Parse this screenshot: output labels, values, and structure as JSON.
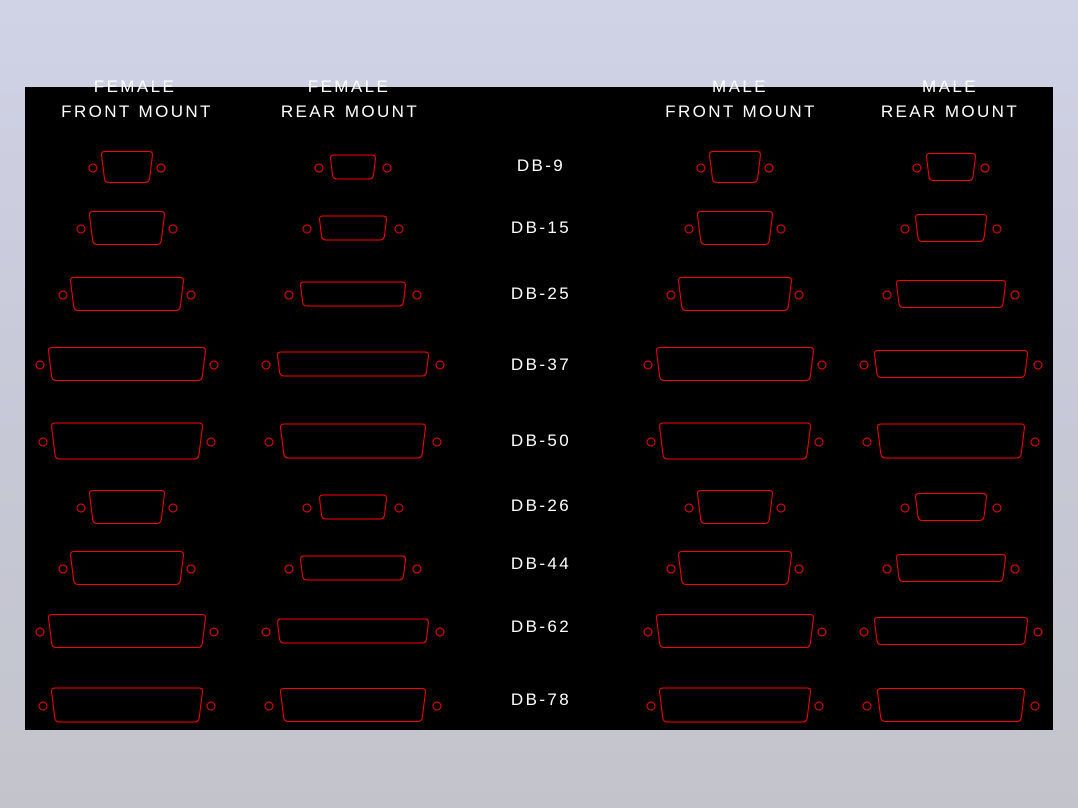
{
  "colors": {
    "canvas": "#000000",
    "outline": "#ff0000",
    "text": "#ffffff"
  },
  "headers": [
    {
      "line1": "FEMALE",
      "line2": "FRONT MOUNT"
    },
    {
      "line1": "FEMALE",
      "line2": "REAR MOUNT"
    },
    {
      "line1": "MALE",
      "line2": "FRONT MOUNT"
    },
    {
      "line1": "MALE",
      "line2": "REAR MOUNT"
    }
  ],
  "connectors": [
    {
      "label": "DB-9"
    },
    {
      "label": "DB-15"
    },
    {
      "label": "DB-25"
    },
    {
      "label": "DB-37"
    },
    {
      "label": "DB-50"
    },
    {
      "label": "DB-26"
    },
    {
      "label": "DB-44"
    },
    {
      "label": "DB-62"
    },
    {
      "label": "DB-78"
    }
  ]
}
